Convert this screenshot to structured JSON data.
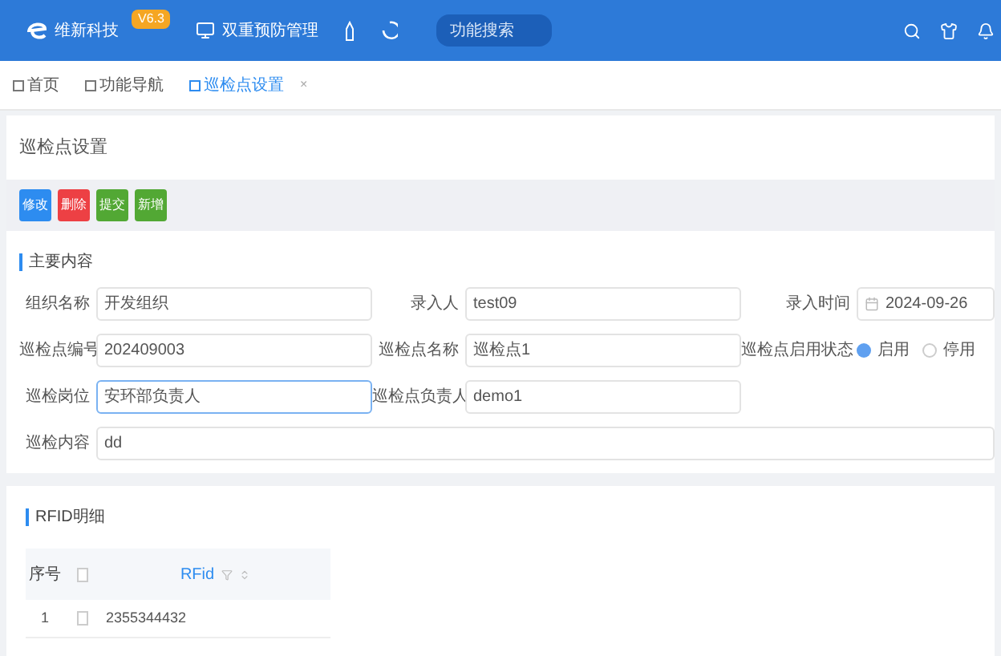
{
  "header": {
    "logo_text": "维新科技",
    "version": "V6.3",
    "module": "双重预防管理",
    "search": {
      "placeholder": "功能搜索"
    }
  },
  "tabs": [
    {
      "label": "首页",
      "selected": false,
      "closable": false
    },
    {
      "label": "功能导航",
      "selected": false,
      "closable": false
    },
    {
      "label": "巡检点设置",
      "selected": true,
      "closable": true,
      "close": "×"
    }
  ],
  "page_title": "巡检点设置",
  "toolbar": [
    {
      "label": "修改",
      "kind": "primary"
    },
    {
      "label": "删除",
      "kind": "danger"
    },
    {
      "label": "提交",
      "kind": "success"
    },
    {
      "label": "新增",
      "kind": "success"
    }
  ],
  "main_section": {
    "title": "主要内容",
    "rows": [
      [
        {
          "label": "组织名称",
          "kind": "text",
          "value": "开发组织"
        },
        {
          "label": "录入人",
          "kind": "text",
          "value": "test09"
        },
        {
          "label": "录入时间",
          "kind": "date",
          "value": "2024-09-26"
        }
      ],
      [
        {
          "label": "巡检点编号",
          "kind": "text",
          "value": "202409003"
        },
        {
          "label": "巡检点名称",
          "kind": "text",
          "value": "巡检点1"
        },
        {
          "label": "巡检点启用状态",
          "kind": "radio",
          "options": [
            {
              "label": "启用",
              "selected": true
            },
            {
              "label": "停用",
              "selected": false
            }
          ]
        }
      ],
      [
        {
          "label": "巡检岗位",
          "kind": "text",
          "value": "安环部负责人",
          "focused": true
        },
        {
          "label": "巡检点负责人",
          "kind": "text",
          "value": "demo1"
        }
      ],
      [
        {
          "label": "巡检内容",
          "kind": "wide",
          "value": "dd"
        }
      ]
    ]
  },
  "rfid_section": {
    "title": "RFID明细",
    "table": {
      "all_checked": false,
      "columns": [
        "序号",
        "RFid"
      ],
      "rows": [
        {
          "index": "1",
          "checked": false,
          "rfid": "2355344432"
        }
      ]
    }
  }
}
